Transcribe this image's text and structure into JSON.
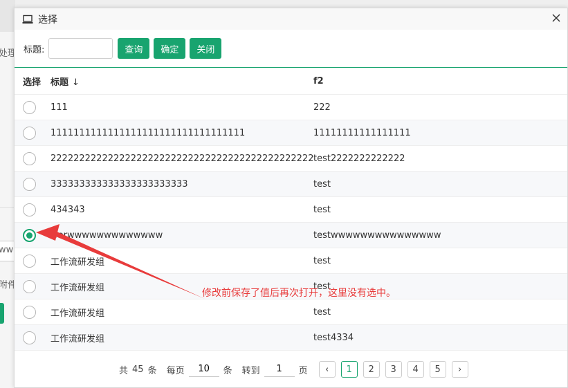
{
  "background": {
    "texts": [
      "处理",
      "ww",
      "附件"
    ]
  },
  "dialog": {
    "title": "选择",
    "title_icon": "laptop-icon",
    "close_icon": "close-icon"
  },
  "toolbar": {
    "title_label": "标题:",
    "title_value": "",
    "query_label": "查询",
    "confirm_label": "确定",
    "close_label": "关闭"
  },
  "table": {
    "headers": {
      "select": "选择",
      "title": "标题",
      "title_sort_icon": "↓",
      "f2": "f2"
    },
    "rows": [
      {
        "title": "111",
        "f2": "222",
        "checked": false
      },
      {
        "title": "1111111111111111111111111111111111",
        "f2": "11111111111111111",
        "checked": false
      },
      {
        "title": "2222222222222222222222222222222222222222222222",
        "f2": "test2222222222222",
        "checked": false
      },
      {
        "title": "333333333333333333333333",
        "f2": "test",
        "checked": false
      },
      {
        "title": "434343",
        "f2": "test",
        "checked": false
      },
      {
        "title": "werwwwwwwwwwwwww",
        "f2": "testwwwwwwwwwwwwwww",
        "checked": true
      },
      {
        "title": "工作流研发组",
        "f2": "test",
        "checked": false
      },
      {
        "title": "工作流研发组",
        "f2": "test",
        "checked": false
      },
      {
        "title": "工作流研发组",
        "f2": "test",
        "checked": false
      },
      {
        "title": "工作流研发组",
        "f2": "test4334",
        "checked": false
      }
    ]
  },
  "pager": {
    "total_prefix": "共",
    "total": "45",
    "total_suffix": "条",
    "per_page_prefix": "每页",
    "per_page": "10",
    "per_page_suffix": "条",
    "goto_prefix": "转到",
    "goto_page": "1",
    "goto_suffix": "页",
    "prev_icon": "‹",
    "next_icon": "›",
    "pages": [
      "1",
      "2",
      "3",
      "4",
      "5"
    ],
    "current_page": "1"
  },
  "annotation": {
    "text": "修改前保存了值后再次打开，这里没有选中。",
    "color": "#e83b3b"
  },
  "colors": {
    "accent": "#18a46f"
  }
}
